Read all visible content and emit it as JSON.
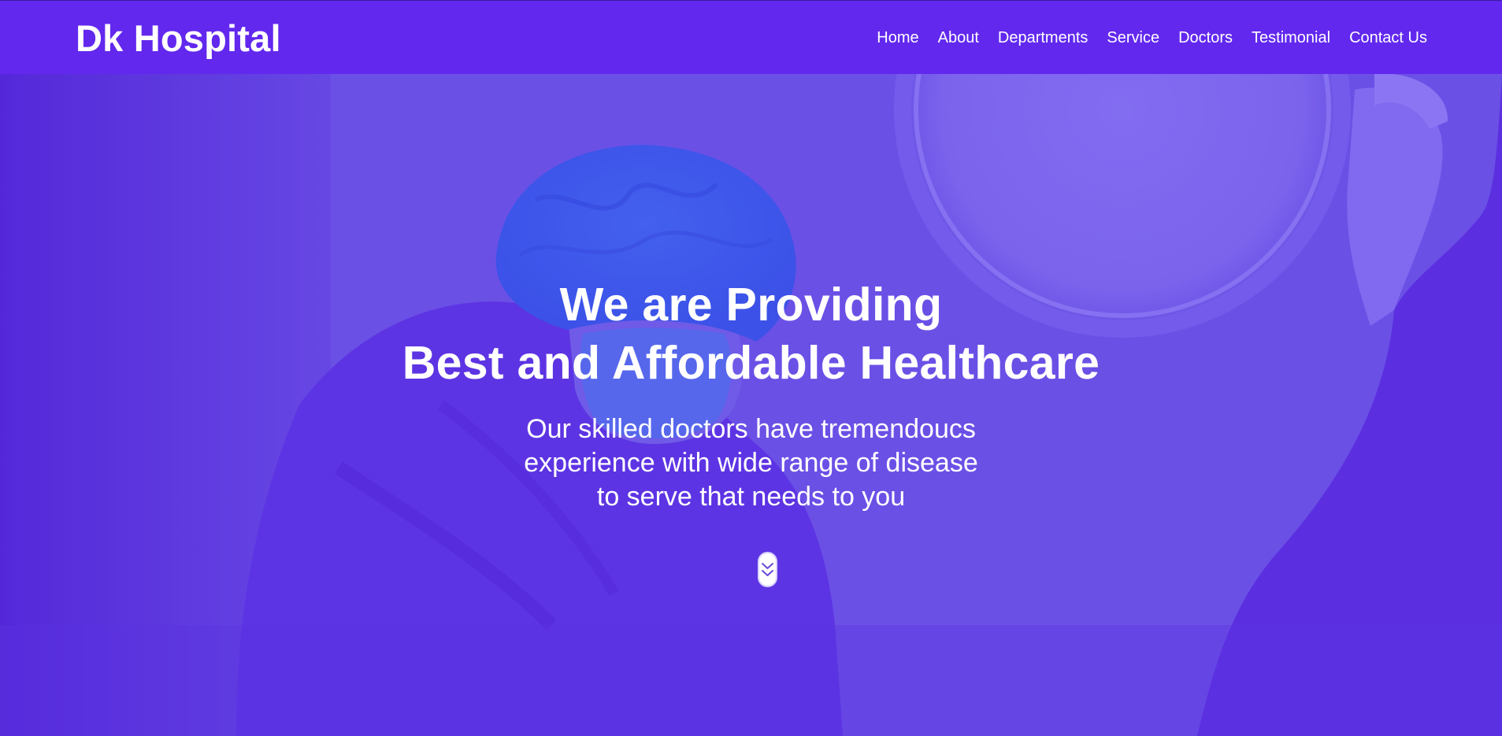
{
  "brand": {
    "name": "Dk Hospital"
  },
  "nav": {
    "items": [
      {
        "label": "Home"
      },
      {
        "label": "About"
      },
      {
        "label": "Departments"
      },
      {
        "label": "Service"
      },
      {
        "label": "Doctors"
      },
      {
        "label": "Testimonial"
      },
      {
        "label": "Contact Us"
      }
    ]
  },
  "hero": {
    "headline_line1": "We are Providing",
    "headline_line2": "Best and Affordable Healthcare",
    "sub_line1": "Our skilled doctors have tremendoucs",
    "sub_line2": "experience with wide range of disease",
    "sub_line3": "to serve that needs to you",
    "scroll_icon": "chevron-double-down-icon",
    "background_image": "surgeon-in-scrub-cap-and-mask-photo"
  },
  "colors": {
    "navbar": "#6228ee",
    "overlay": "#5b2be0",
    "text": "#ffffff"
  }
}
